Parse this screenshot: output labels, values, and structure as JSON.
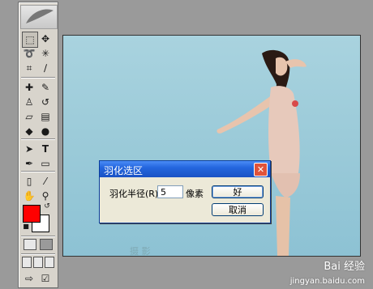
{
  "dialog": {
    "title": "羽化选区",
    "close_glyph": "✕",
    "feather_label": "羽化半径(R):",
    "feather_value": "5",
    "unit": "像素",
    "ok_label": "好",
    "cancel_label": "取消"
  },
  "toolbox": {
    "tools": [
      {
        "name": "marquee-tool-icon",
        "glyph": "⬚"
      },
      {
        "name": "move-tool-icon",
        "glyph": "✥"
      },
      {
        "name": "lasso-tool-icon",
        "glyph": "➰"
      },
      {
        "name": "magic-wand-tool-icon",
        "glyph": "✳"
      },
      {
        "name": "crop-tool-icon",
        "glyph": "⌗"
      },
      {
        "name": "slice-tool-icon",
        "glyph": "∕"
      },
      {
        "name": "healing-brush-tool-icon",
        "glyph": "✚"
      },
      {
        "name": "brush-tool-icon",
        "glyph": "✎"
      },
      {
        "name": "clone-stamp-tool-icon",
        "glyph": "♙"
      },
      {
        "name": "history-brush-tool-icon",
        "glyph": "↺"
      },
      {
        "name": "eraser-tool-icon",
        "glyph": "▱"
      },
      {
        "name": "gradient-tool-icon",
        "glyph": "▤"
      },
      {
        "name": "blur-tool-icon",
        "glyph": "◆"
      },
      {
        "name": "dodge-tool-icon",
        "glyph": "●"
      },
      {
        "name": "path-selection-tool-icon",
        "glyph": "➤"
      },
      {
        "name": "type-tool-icon",
        "glyph": "T"
      },
      {
        "name": "pen-tool-icon",
        "glyph": "✒"
      },
      {
        "name": "shape-tool-icon",
        "glyph": "▭"
      },
      {
        "name": "notes-tool-icon",
        "glyph": "▯"
      },
      {
        "name": "eyedropper-tool-icon",
        "glyph": "⁄"
      },
      {
        "name": "hand-tool-icon",
        "glyph": "✋"
      },
      {
        "name": "zoom-tool-icon",
        "glyph": "⚲"
      }
    ],
    "foreground_color": "#ff0000",
    "background_color": "#ffffff"
  },
  "watermark": {
    "brand": "Bai 经验",
    "url": "jingyan.baidu.com"
  }
}
